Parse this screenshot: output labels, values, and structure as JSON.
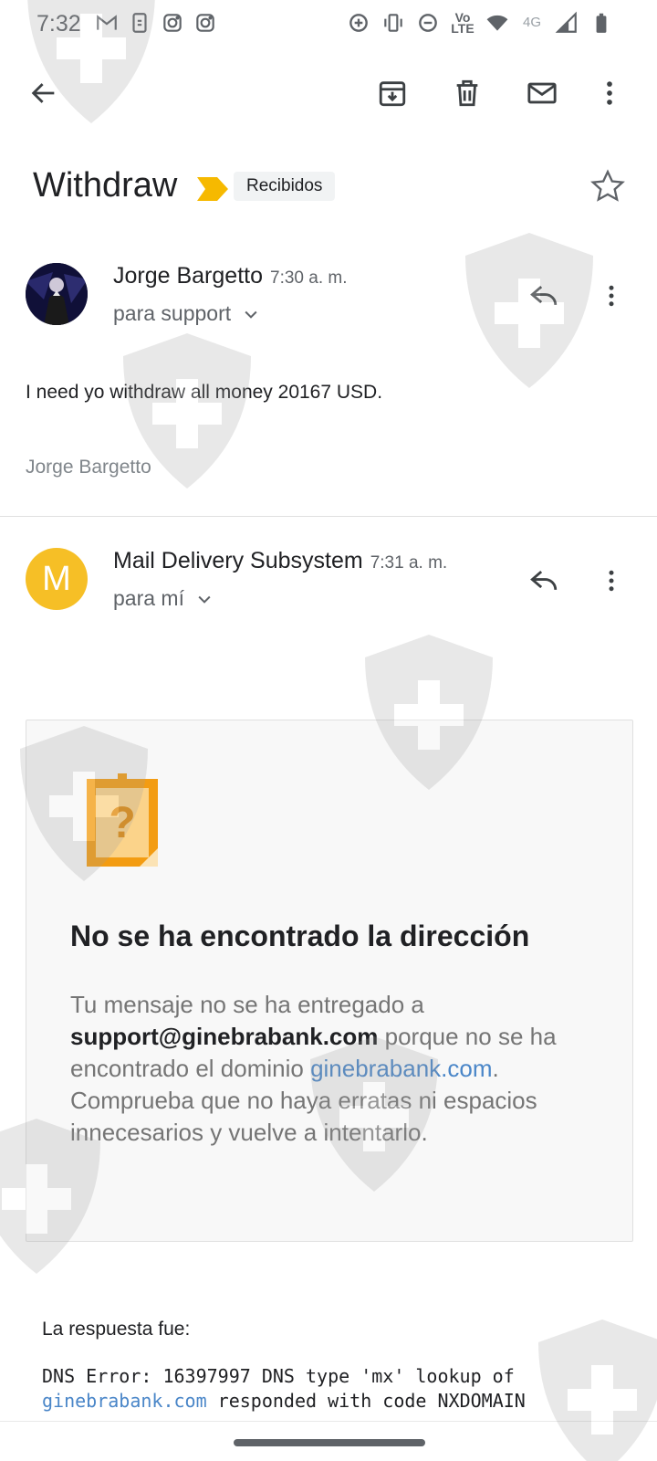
{
  "status_bar": {
    "time": "7:32",
    "network": "4G",
    "volte": "Vo LTE",
    "left_icons": [
      "gmail-icon",
      "phone-data-icon",
      "instagram-icon",
      "instagram-icon"
    ],
    "right_icons": [
      "data-saver-icon",
      "vibrate-icon",
      "do-not-disturb-icon",
      "volte-icon",
      "wifi-icon",
      "signal-icon",
      "battery-icon"
    ]
  },
  "toolbar": {
    "back_icon": "arrow-left-icon",
    "archive_icon": "archive-icon",
    "delete_icon": "trash-icon",
    "mark_unread_icon": "mail-icon",
    "more_icon": "more-vertical-icon"
  },
  "thread": {
    "subject": "Withdraw",
    "label": "Recibidos",
    "label_color": "#f6b900"
  },
  "messages": [
    {
      "sender": "Jorge Bargetto",
      "time": "7:30 a. m.",
      "recipient": "para support",
      "body": "I need yo withdraw all money 20167 USD.",
      "signature": "Jorge Bargetto"
    },
    {
      "sender": "Mail Delivery Subsystem",
      "avatar_letter": "M",
      "avatar_color": "#f6bf26",
      "time": "7:31 a. m.",
      "recipient": "para mí"
    }
  ],
  "bounce": {
    "title": "No se ha encontrado la dirección",
    "text_1": "Tu mensaje no se ha entregado a ",
    "email": "support@ginebrabank.com",
    "text_2": " porque no se ha encontrado el dominio ",
    "domain": "ginebrabank.com",
    "text_3": ". Comprueba que no haya erratas ni espacios innecesarios y vuelve a intentarlo."
  },
  "response": {
    "label": "La respuesta fue:",
    "line_1": "DNS Error: 16397997 DNS type 'mx' lookup of",
    "line_2_domain": "ginebrabank.com",
    "line_2_rest": " responded with code NXDOMAIN"
  },
  "colors": {
    "link": "#4a86c8",
    "text_secondary": "#5f6368"
  }
}
